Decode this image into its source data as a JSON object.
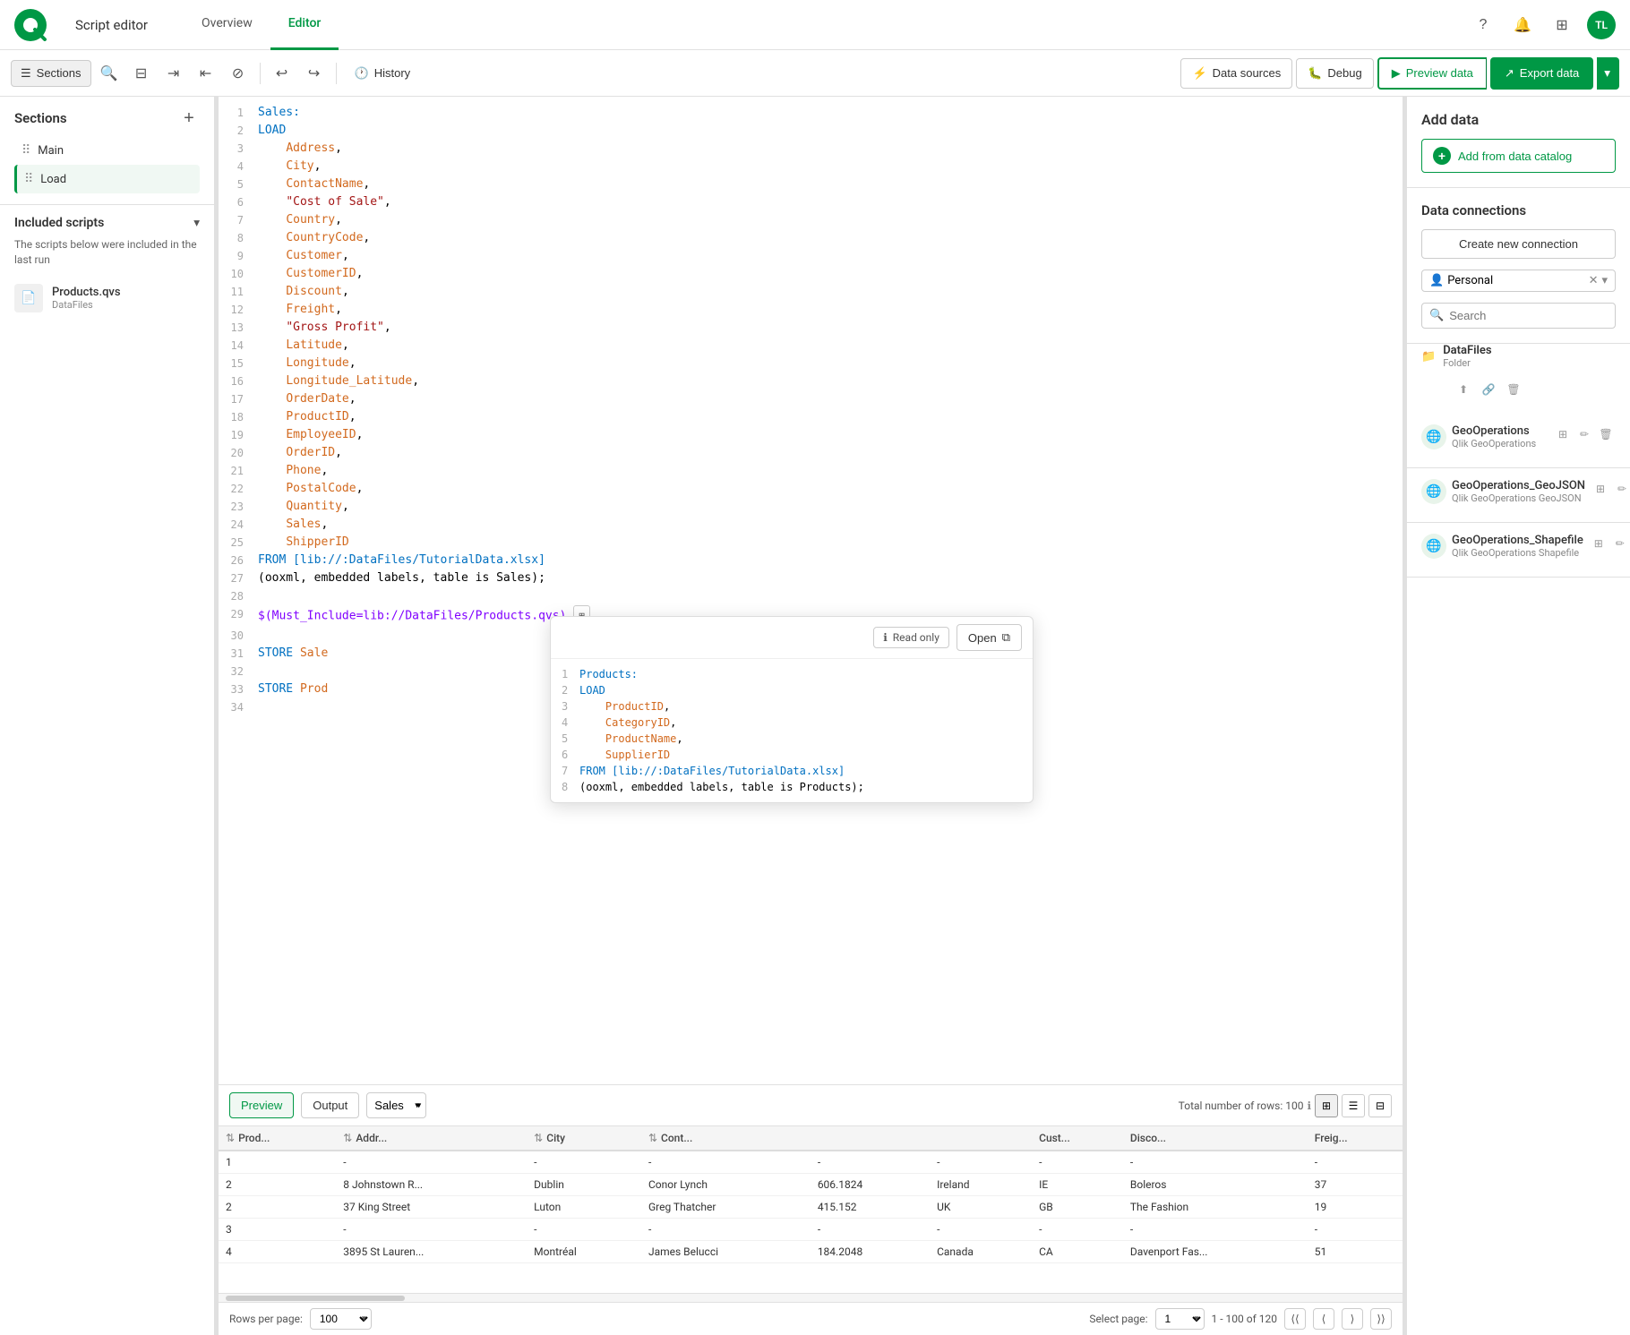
{
  "app": {
    "logo_text": "Qlik",
    "title": "Script editor",
    "nav_tabs": [
      {
        "label": "Overview",
        "active": false
      },
      {
        "label": "Editor",
        "active": true
      }
    ],
    "avatar": "TL"
  },
  "toolbar": {
    "sections_label": "Sections",
    "history_label": "History",
    "data_sources_label": "Data sources",
    "debug_label": "Debug",
    "preview_label": "Preview data",
    "export_label": "Export data"
  },
  "left_panel": {
    "sections_title": "Sections",
    "add_tooltip": "Add section",
    "items": [
      {
        "label": "Main",
        "active": false
      },
      {
        "label": "Load",
        "active": true
      }
    ],
    "included_scripts_title": "Included scripts",
    "included_scripts_desc": "The scripts below were included in the last run",
    "scripts": [
      {
        "name": "Products.qvs",
        "path": "DataFiles"
      }
    ]
  },
  "code": {
    "lines": [
      {
        "num": 1,
        "content": "Sales:",
        "type": "label"
      },
      {
        "num": 2,
        "content": "LOAD",
        "type": "keyword"
      },
      {
        "num": 3,
        "content": "    Address,",
        "type": "field"
      },
      {
        "num": 4,
        "content": "    City,",
        "type": "field"
      },
      {
        "num": 5,
        "content": "    ContactName,",
        "type": "field"
      },
      {
        "num": 6,
        "content": "    \"Cost of Sale\",",
        "type": "field"
      },
      {
        "num": 7,
        "content": "    Country,",
        "type": "field"
      },
      {
        "num": 8,
        "content": "    CountryCode,",
        "type": "field"
      },
      {
        "num": 9,
        "content": "    Customer,",
        "type": "field"
      },
      {
        "num": 10,
        "content": "    CustomerID,",
        "type": "field"
      },
      {
        "num": 11,
        "content": "    Discount,",
        "type": "field"
      },
      {
        "num": 12,
        "content": "    Freight,",
        "type": "field"
      },
      {
        "num": 13,
        "content": "    \"Gross Profit\",",
        "type": "field"
      },
      {
        "num": 14,
        "content": "    Latitude,",
        "type": "field"
      },
      {
        "num": 15,
        "content": "    Longitude,",
        "type": "field"
      },
      {
        "num": 16,
        "content": "    Longitude_Latitude,",
        "type": "field"
      },
      {
        "num": 17,
        "content": "    OrderDate,",
        "type": "field"
      },
      {
        "num": 18,
        "content": "    ProductID,",
        "type": "field"
      },
      {
        "num": 19,
        "content": "    EmployeeID,",
        "type": "field"
      },
      {
        "num": 20,
        "content": "    OrderID,",
        "type": "field"
      },
      {
        "num": 21,
        "content": "    Phone,",
        "type": "field"
      },
      {
        "num": 22,
        "content": "    PostalCode,",
        "type": "field"
      },
      {
        "num": 23,
        "content": "    Quantity,",
        "type": "field"
      },
      {
        "num": 24,
        "content": "    Sales,",
        "type": "field"
      },
      {
        "num": 25,
        "content": "    ShipperID",
        "type": "field"
      },
      {
        "num": 26,
        "content": "FROM [lib://:DataFiles/TutorialData.xlsx]",
        "type": "from"
      },
      {
        "num": 27,
        "content": "(ooxml, embedded labels, table is Sales);",
        "type": "options"
      },
      {
        "num": 28,
        "content": "",
        "type": "empty"
      },
      {
        "num": 29,
        "content": "$(Must_Include=lib://DataFiles/Products.qvs)",
        "type": "variable"
      },
      {
        "num": 30,
        "content": "",
        "type": "empty"
      },
      {
        "num": 31,
        "content": "STORE Sale",
        "type": "store"
      },
      {
        "num": 32,
        "content": "",
        "type": "empty"
      },
      {
        "num": 33,
        "content": "STORE Prod",
        "type": "store"
      },
      {
        "num": 34,
        "content": "",
        "type": "empty"
      }
    ]
  },
  "popup": {
    "read_only_label": "Read only",
    "open_label": "Open",
    "lines": [
      {
        "num": 1,
        "content": "Products:",
        "type": "label"
      },
      {
        "num": 2,
        "content": "LOAD",
        "type": "keyword"
      },
      {
        "num": 3,
        "content": "    ProductID,",
        "type": "field"
      },
      {
        "num": 4,
        "content": "    CategoryID,",
        "type": "field"
      },
      {
        "num": 5,
        "content": "    ProductName,",
        "type": "field"
      },
      {
        "num": 6,
        "content": "    SupplierID",
        "type": "field"
      },
      {
        "num": 7,
        "content": "FROM [lib://:DataFiles/TutorialData.xlsx]",
        "type": "from"
      },
      {
        "num": 8,
        "content": "(ooxml, embedded labels, table is Products);",
        "type": "options"
      }
    ]
  },
  "right_panel": {
    "add_data_title": "Add data",
    "add_catalog_label": "Add from data catalog",
    "connections_title": "Data connections",
    "create_conn_label": "Create new connection",
    "filter_value": "Personal",
    "search_placeholder": "Search",
    "datafiles_title": "DataFiles",
    "datafiles_subtitle": "Folder",
    "connections": [
      {
        "name": "GeoOperations",
        "desc": "Qlik GeoOperations",
        "type": "globe"
      },
      {
        "name": "GeoOperations_GeoJSON",
        "desc": "Qlik GeoOperations GeoJSON",
        "type": "globe"
      },
      {
        "name": "GeoOperations_Shapefile",
        "desc": "Qlik GeoOperations Shapefile",
        "type": "globe"
      }
    ],
    "total_rows_label": "Total number of rows: 100"
  },
  "bottom": {
    "preview_label": "Preview",
    "output_label": "Output",
    "sales_option": "Sales",
    "table_headers": [
      "Prod...",
      "Addr...",
      "City",
      "Cont...",
      "",
      "",
      "Cust...",
      "Disco...",
      "Freig..."
    ],
    "rows": [
      {
        "id": "1",
        "addr": "-",
        "city": "-",
        "cont": "-",
        "col5": "-",
        "col6": "-",
        "cust": "-",
        "disc": "-",
        "freig": "-"
      },
      {
        "id": "2",
        "addr": "8 Johnstown R...",
        "city": "Dublin",
        "cont": "Conor Lynch",
        "col5": "606.1824",
        "col6": "Ireland",
        "cust": "IE",
        "disc": "Boleros",
        "freig": "37"
      },
      {
        "id": "2",
        "addr": "37 King Street",
        "city": "Luton",
        "cont": "Greg Thatcher",
        "col5": "415.152",
        "col6": "UK",
        "cust": "GB",
        "disc": "The Fashion",
        "freig": "19"
      },
      {
        "id": "3",
        "addr": "-",
        "city": "-",
        "cont": "-",
        "col5": "-",
        "col6": "-",
        "cust": "-",
        "disc": "-",
        "freig": "-"
      },
      {
        "id": "4",
        "addr": "3895 St Lauren...",
        "city": "Montréal",
        "cont": "James Belucci",
        "col5": "184.2048",
        "col6": "Canada",
        "cust": "CA",
        "disc": "Davenport Fas...",
        "freig": "51"
      }
    ],
    "pagination": {
      "rows_per_page_label": "Rows per page:",
      "rows_per_page_value": "100",
      "select_page_label": "Select page:",
      "page_value": "1",
      "range_label": "1 - 100 of 120"
    }
  }
}
